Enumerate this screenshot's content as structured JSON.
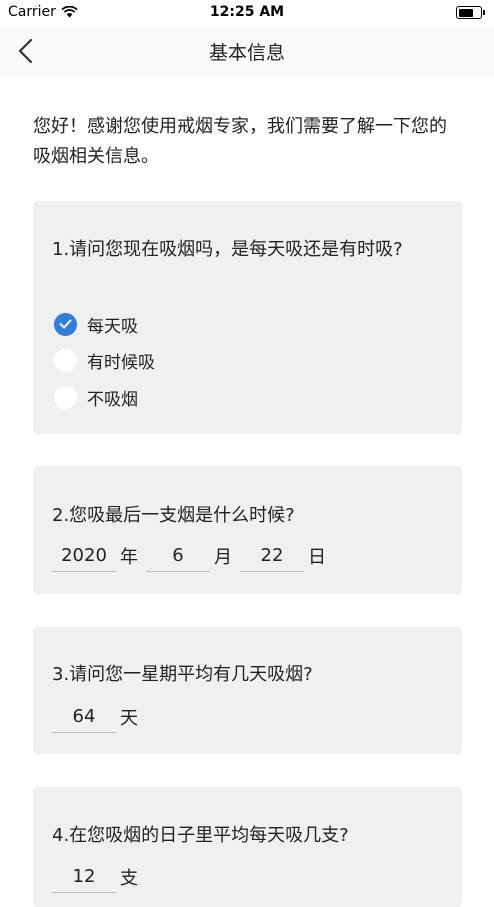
{
  "status": {
    "carrier": "Carrier",
    "time": "12:25 AM",
    "battery_level": 0.7
  },
  "nav": {
    "title": "基本信息"
  },
  "intro": "您好！感谢您使用戒烟专家，我们需要了解一下您的吸烟相关信息。",
  "q1": {
    "question": "1.请问您现在吸烟吗，是每天吸还是有时吸?",
    "options": [
      {
        "label": "每天吸",
        "checked": true
      },
      {
        "label": "有时候吸",
        "checked": false
      },
      {
        "label": "不吸烟",
        "checked": false
      }
    ]
  },
  "q2": {
    "question": "2.您吸最后一支烟是什么时候?",
    "year": "2020",
    "year_unit": "年",
    "month": "6",
    "month_unit": "月",
    "day": "22",
    "day_unit": "日"
  },
  "q3": {
    "question": "3.请问您一星期平均有几天吸烟?",
    "value": "64",
    "unit": "天"
  },
  "q4": {
    "question": "4.在您吸烟的日子里平均每天吸几支?",
    "value": "12",
    "unit": "支"
  },
  "colors": {
    "accent": "#2f7de1",
    "card": "#f0f0f0",
    "nav": "#fafafa"
  }
}
